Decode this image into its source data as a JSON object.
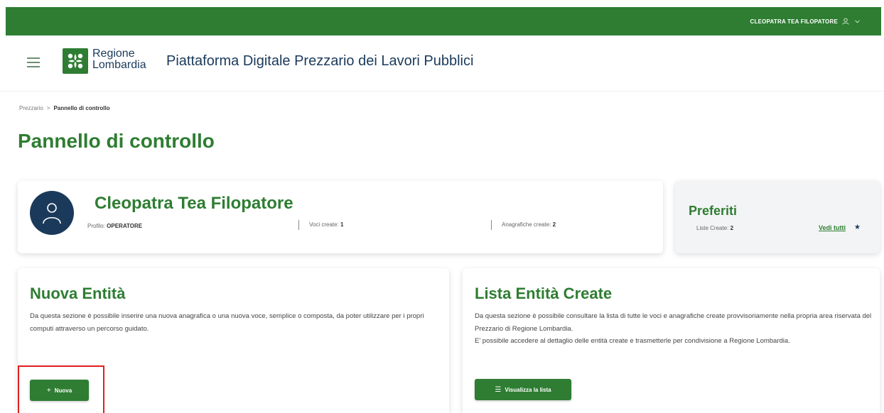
{
  "topbar": {
    "user_label": "CLEOPATRA TEA FILOPATORE"
  },
  "header": {
    "brand_line1": "Regione",
    "brand_line2": "Lombardia",
    "site_title": "Piattaforma Digitale Prezzario dei Lavori Pubblici"
  },
  "breadcrumb": {
    "root": "Prezzario",
    "separator": ">",
    "current": "Pannello di controllo"
  },
  "page_title": "Pannello di controllo",
  "profile": {
    "name": "Cleopatra Tea Filopatore",
    "profile_label": "Profilo:",
    "profile_value": "OPERATORE",
    "voci_label": "Voci create:",
    "voci_value": "1",
    "anagrafiche_label": "Anagrafiche create:",
    "anagrafiche_value": "2"
  },
  "favorites": {
    "title": "Preferiti",
    "lists_label": "Liste Create:",
    "lists_value": "2",
    "see_all": "Vedi tutti",
    "star_icon": "★"
  },
  "new_entity": {
    "title": "Nuova Entità",
    "description": "Da questa sezione è possibile inserire una nuova anagrafica o una nuova voce, semplice o composta, da poter utilizzare per i propri computi attraverso un percorso guidato.",
    "button_icon": "+",
    "button_label": "Nuova"
  },
  "list_entities": {
    "title": "Lista Entità Create",
    "description_1": "Da questa sezione è possibile consultare la lista di tutte le voci e anagrafiche create provvisoriamente nella propria area riservata del Prezzario di Regione Lombardia.",
    "description_2": "E' possibile accedere al dettaglio delle entità create e trasmetterle per condivisione a Regione Lombardia.",
    "button_icon": "☰",
    "button_label": "Visualizza la lista"
  },
  "colors": {
    "primary_green": "#2e7d32",
    "navy": "#1b3a5b",
    "highlight_red": "#e02020"
  }
}
